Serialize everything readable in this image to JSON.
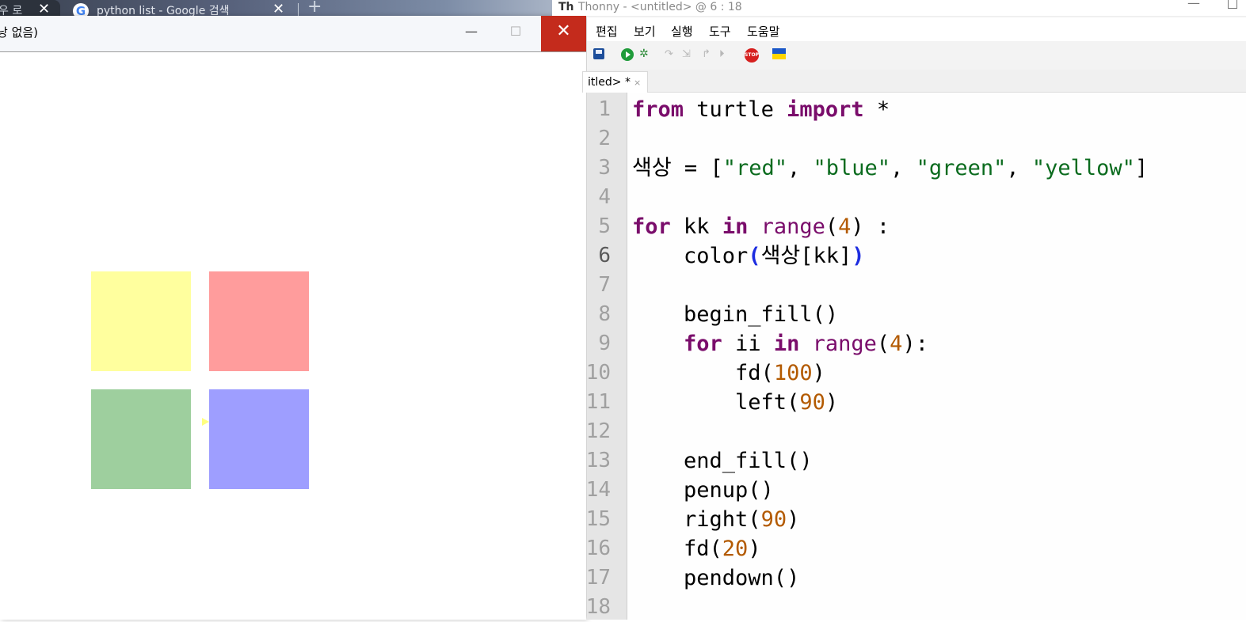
{
  "chrome": {
    "tab1_text": "우 로",
    "tab1_close": "✕",
    "tab2_favicon": "G",
    "tab2_title": "python list - Google 검색",
    "tab2_close": "✕",
    "new_tab": "+"
  },
  "turtle": {
    "title": "낭 없음)",
    "min": "—",
    "max": "☐",
    "close": "✕",
    "squares": [
      {
        "name": "yellow-square",
        "color": "#ffff9e"
      },
      {
        "name": "red-square",
        "color": "#ff9c9c"
      },
      {
        "name": "green-square",
        "color": "#9ecf9e"
      },
      {
        "name": "blue-square",
        "color": "#9e9eff"
      }
    ]
  },
  "thonny": {
    "title": "Thonny  -  <untitled>  @  6 : 18",
    "logo": "Th",
    "min": "—",
    "menu": [
      "편집",
      "보기",
      "실행",
      "도구",
      "도움말"
    ],
    "toolbar": {
      "debug": "✲",
      "step_over": "↷",
      "step_into": "⇲",
      "step_out": "↱",
      "resume": "⏵",
      "stop": "STOP"
    },
    "tab_label": "itled> *",
    "tab_close": "×",
    "current_line": 6,
    "line_numbers": [
      "1",
      "2",
      "3",
      "4",
      "5",
      "6",
      "7",
      "8",
      "9",
      "10",
      "11",
      "12",
      "13",
      "14",
      "15",
      "16",
      "17",
      "18"
    ],
    "code": [
      [
        {
          "t": "from",
          "c": "kw"
        },
        {
          "t": " turtle ",
          "c": ""
        },
        {
          "t": "import",
          "c": "kw"
        },
        {
          "t": " *",
          "c": ""
        }
      ],
      [],
      [
        {
          "t": "색상 = [",
          "c": ""
        },
        {
          "t": "\"red\"",
          "c": "st"
        },
        {
          "t": ", ",
          "c": ""
        },
        {
          "t": "\"blue\"",
          "c": "st"
        },
        {
          "t": ", ",
          "c": ""
        },
        {
          "t": "\"green\"",
          "c": "st"
        },
        {
          "t": ", ",
          "c": ""
        },
        {
          "t": "\"yellow\"",
          "c": "st"
        },
        {
          "t": "]",
          "c": ""
        }
      ],
      [],
      [
        {
          "t": "for",
          "c": "kw"
        },
        {
          "t": " kk ",
          "c": ""
        },
        {
          "t": "in",
          "c": "kw"
        },
        {
          "t": " ",
          "c": ""
        },
        {
          "t": "range",
          "c": "bi"
        },
        {
          "t": "(",
          "c": ""
        },
        {
          "t": "4",
          "c": "nu"
        },
        {
          "t": ") :",
          "c": ""
        }
      ],
      [
        {
          "t": "    color",
          "c": ""
        },
        {
          "t": "(",
          "c": "pb"
        },
        {
          "t": "색상[kk]",
          "c": ""
        },
        {
          "t": ")",
          "c": "pb"
        }
      ],
      [],
      [
        {
          "t": "    begin_fill()",
          "c": ""
        }
      ],
      [
        {
          "t": "    ",
          "c": ""
        },
        {
          "t": "for",
          "c": "kw"
        },
        {
          "t": " ii ",
          "c": ""
        },
        {
          "t": "in",
          "c": "kw"
        },
        {
          "t": " ",
          "c": ""
        },
        {
          "t": "range",
          "c": "bi"
        },
        {
          "t": "(",
          "c": ""
        },
        {
          "t": "4",
          "c": "nu"
        },
        {
          "t": "):",
          "c": ""
        }
      ],
      [
        {
          "t": "        fd(",
          "c": ""
        },
        {
          "t": "100",
          "c": "nu"
        },
        {
          "t": ")",
          "c": ""
        }
      ],
      [
        {
          "t": "        left(",
          "c": ""
        },
        {
          "t": "90",
          "c": "nu"
        },
        {
          "t": ")",
          "c": ""
        }
      ],
      [],
      [
        {
          "t": "    end_fill()",
          "c": ""
        }
      ],
      [
        {
          "t": "    penup()",
          "c": ""
        }
      ],
      [
        {
          "t": "    right(",
          "c": ""
        },
        {
          "t": "90",
          "c": "nu"
        },
        {
          "t": ")",
          "c": ""
        }
      ],
      [
        {
          "t": "    fd(",
          "c": ""
        },
        {
          "t": "20",
          "c": "nu"
        },
        {
          "t": ")",
          "c": ""
        }
      ],
      [
        {
          "t": "    pendown()",
          "c": ""
        }
      ],
      []
    ]
  }
}
